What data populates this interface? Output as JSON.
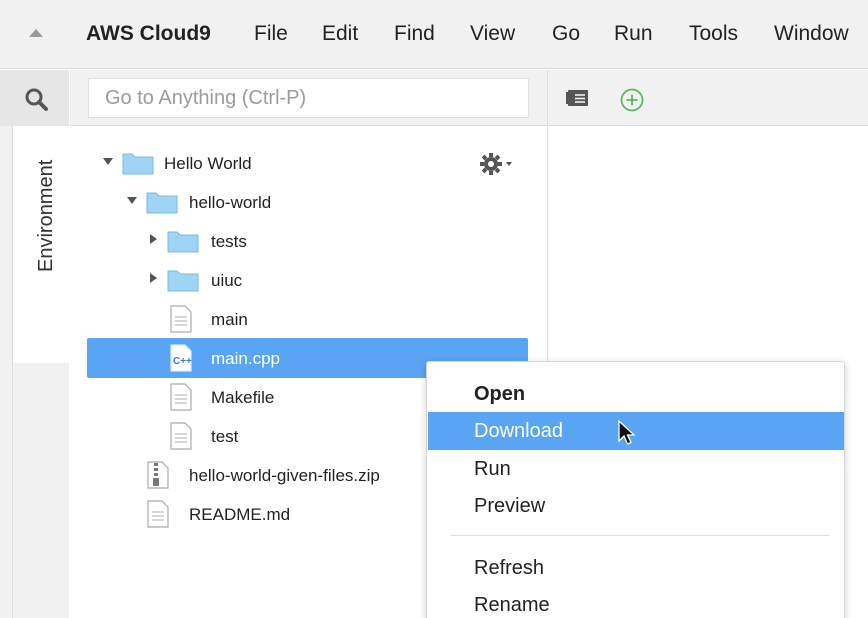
{
  "menubar": {
    "brand": "AWS Cloud9",
    "items": [
      "File",
      "Edit",
      "Find",
      "View",
      "Go",
      "Run",
      "Tools",
      "Window"
    ]
  },
  "sidebar": {
    "environment_tab": "Environment"
  },
  "goto": {
    "placeholder": "Go to Anything (Ctrl-P)"
  },
  "tree": {
    "items": [
      {
        "label": "Hello World",
        "type": "folder",
        "expanded": true
      },
      {
        "label": "hello-world",
        "type": "folder",
        "expanded": true
      },
      {
        "label": "tests",
        "type": "folder",
        "expanded": false
      },
      {
        "label": "uiuc",
        "type": "folder",
        "expanded": false
      },
      {
        "label": "main",
        "type": "file"
      },
      {
        "label": "main.cpp",
        "type": "cpp-file",
        "selected": true
      },
      {
        "label": "Makefile",
        "type": "file"
      },
      {
        "label": "test",
        "type": "file"
      },
      {
        "label": "hello-world-given-files.zip",
        "type": "zip-file"
      },
      {
        "label": "README.md",
        "type": "file"
      }
    ]
  },
  "context_menu": {
    "items": [
      {
        "label": "Open",
        "bold": true
      },
      {
        "label": "Download",
        "highlighted": true
      },
      {
        "label": "Run"
      },
      {
        "label": "Preview"
      },
      {
        "label": "Refresh"
      },
      {
        "label": "Rename"
      }
    ]
  },
  "colors": {
    "selection": "#5aa4f4",
    "folder": "#9fd4f5",
    "chrome": "#f1f1f1",
    "add_green": "#5cb85c"
  }
}
